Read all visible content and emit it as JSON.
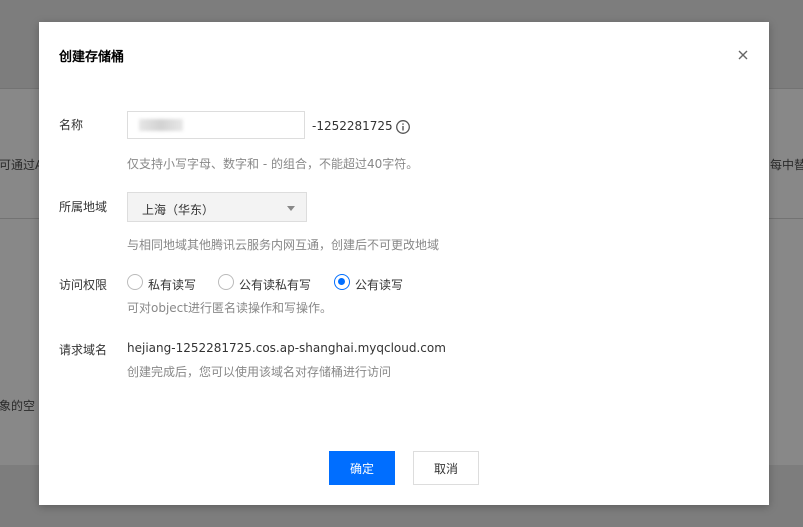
{
  "background": {
    "left_snippet_1": "可通过A",
    "right_snippet_1": "每中替换",
    "left_snippet_2": "象的空"
  },
  "dialog": {
    "title": "创建存储桶",
    "name": {
      "label": "名称",
      "value": "",
      "appid_suffix": "-1252281725",
      "help": "仅支持小写字母、数字和 - 的组合，不能超过40字符。"
    },
    "region": {
      "label": "所属地域",
      "selected": "上海（华东）",
      "help": "与相同地域其他腾讯云服务内网互通，创建后不可更改地域"
    },
    "access": {
      "label": "访问权限",
      "options": [
        {
          "label": "私有读写",
          "checked": false
        },
        {
          "label": "公有读私有写",
          "checked": false
        },
        {
          "label": "公有读写",
          "checked": true
        }
      ],
      "help": "可对object进行匿名读操作和写操作。"
    },
    "domain": {
      "label": "请求域名",
      "value": "hejiang-1252281725.cos.ap-shanghai.myqcloud.com",
      "help": "创建完成后，您可以使用该域名对存储桶进行访问"
    },
    "buttons": {
      "confirm": "确定",
      "cancel": "取消"
    }
  },
  "colors": {
    "primary": "#006eff",
    "overlay": "#7d7d7d"
  }
}
